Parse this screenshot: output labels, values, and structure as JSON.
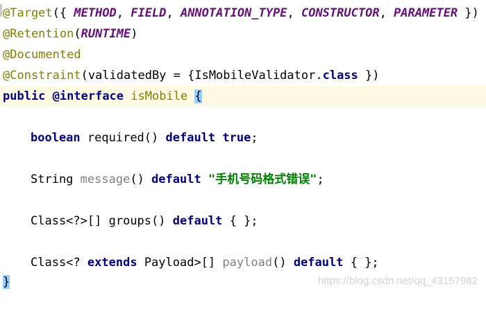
{
  "code": {
    "l1": {
      "ann": "@Target",
      "open": "({ ",
      "c1": "METHOD",
      "c2": "FIELD",
      "c3": "ANNOTATION_TYPE",
      "c4": "CONSTRUCTOR",
      "c5": "PARAMETER",
      "sep": ", ",
      "close": " })"
    },
    "l2": {
      "ann": "@Retention",
      "open": "(",
      "c1": "RUNTIME",
      "close": ")"
    },
    "l3": {
      "ann": "@Documented"
    },
    "l4": {
      "ann": "@Constraint",
      "open": "(validatedBy = {IsMobileValidator.",
      "kw": "class",
      "close": " })"
    },
    "l5": {
      "kw1": "public",
      "kw2": "@interface",
      "name": "isMobile",
      "brace": "{"
    },
    "l6": {
      "type": "boolean",
      "method": "required()",
      "kw": "default",
      "value": "true",
      "end": ";"
    },
    "l7": {
      "type": "String",
      "method": "message",
      "parens": "()",
      "kw": "default",
      "value": "\"手机号码格式错误\"",
      "end": ";"
    },
    "l8": {
      "type": "Class<?>[]",
      "method": "groups()",
      "kw": "default",
      "rest": "{ };"
    },
    "l9": {
      "type": "Class<?",
      "kw1": "extends",
      "type2": "Payload>[]",
      "method": "payload",
      "parens": "()",
      "kw2": "default",
      "rest": "{ };"
    },
    "l10": {
      "brace": "}"
    }
  },
  "watermark": "https://blog.csdn.net/qq_43157982",
  "colors": {
    "annotation": "#808000",
    "keyword": "#000080",
    "constant": "#660e7a",
    "string": "#008000",
    "unused": "#808080",
    "current_line": "#fffae3",
    "brace_match": "#99ccff"
  }
}
